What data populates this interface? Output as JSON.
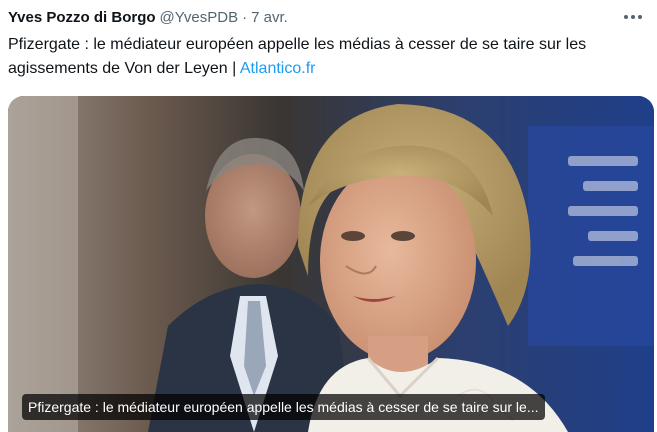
{
  "tweet": {
    "author_name": "Yves Pozzo di Borgo",
    "handle": "@YvesPDB",
    "separator": "·",
    "time": "7 avr.",
    "more_icon": "more-horizontal-icon",
    "text": "Pfizergate : le médiateur européen appelle les médias à cesser de se taire sur les agissements de Von der Leyen | ",
    "link_text": "Atlantico.fr"
  },
  "card": {
    "caption": "Pfizergate : le médiateur européen appelle les médias à cesser de se taire sur le..."
  },
  "colors": {
    "link": "#1d9bf0",
    "secondary_text": "#536471",
    "primary_text": "#0f1419"
  }
}
